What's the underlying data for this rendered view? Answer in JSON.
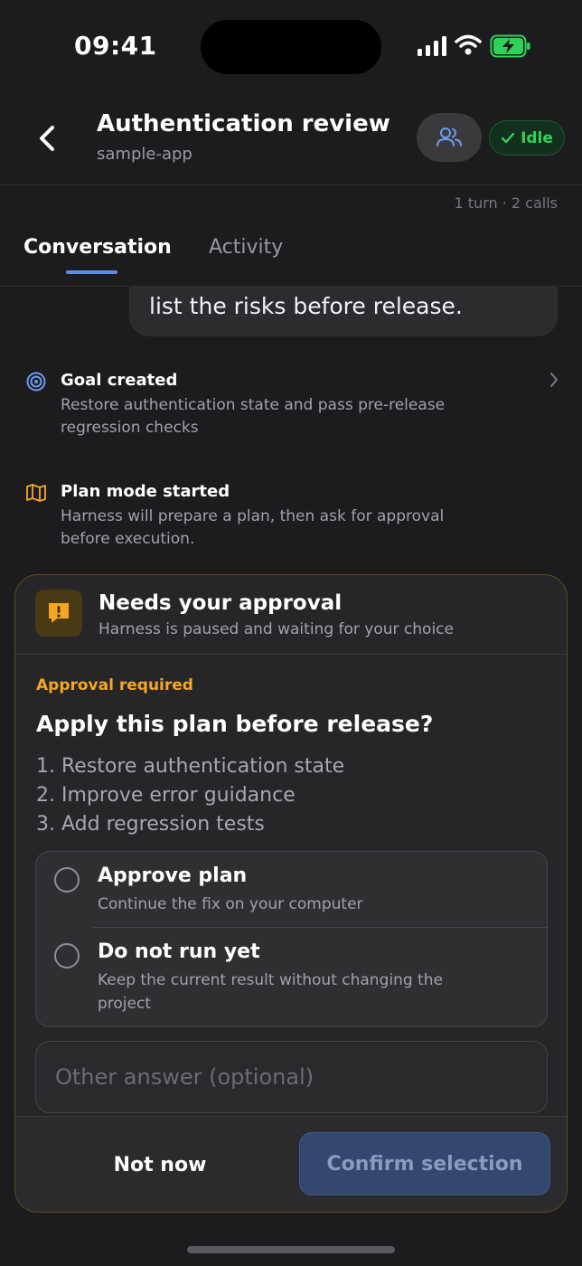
{
  "status_bar": {
    "time": "09:41"
  },
  "header": {
    "title": "Authentication review",
    "subtitle": "sample-app",
    "status_label": "Idle",
    "meta": "1 turn · 2 calls"
  },
  "tabs": [
    {
      "label": "Conversation",
      "active": true
    },
    {
      "label": "Activity",
      "active": false
    }
  ],
  "conversation": {
    "user_message_visible": "list the risks before release.",
    "events": [
      {
        "title": "Goal created",
        "description": "Restore authentication state and pass pre-release regression checks",
        "icon": "target-icon"
      },
      {
        "title": "Plan mode started",
        "description": "Harness will prepare a plan, then ask for approval before execution.",
        "icon": "map-icon"
      }
    ]
  },
  "approval": {
    "title": "Needs your approval",
    "subtitle": "Harness is paused and waiting for your choice",
    "label": "Approval required",
    "question": "Apply this plan before release?",
    "steps": [
      "1. Restore authentication state",
      "2. Improve error guidance",
      "3. Add regression tests"
    ],
    "options": [
      {
        "title": "Approve plan",
        "description": "Continue the fix on your computer"
      },
      {
        "title": "Do not run yet",
        "description": "Keep the current result without changing the project"
      }
    ],
    "other_placeholder": "Other answer (optional)",
    "other_value": "",
    "secondary_button": "Not now",
    "primary_button": "Confirm selection"
  },
  "colors": {
    "background": "#1c1c1e",
    "accent": "#5b8de6",
    "warning": "#f5a623",
    "success": "#30d158"
  }
}
